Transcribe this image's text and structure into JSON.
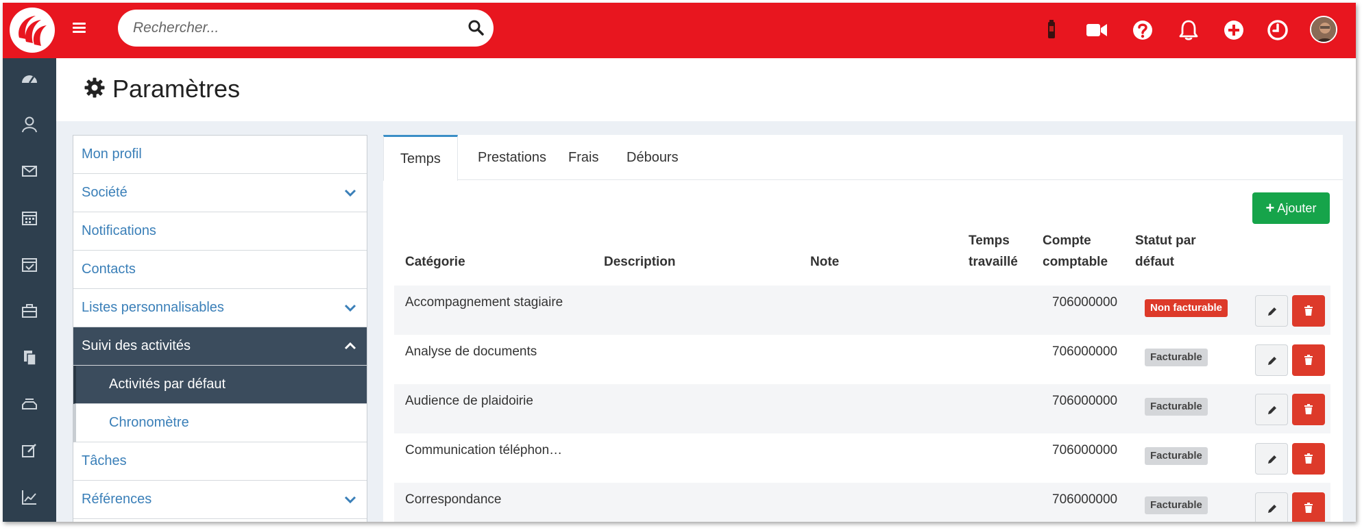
{
  "search": {
    "placeholder": "Rechercher..."
  },
  "page": {
    "title": "Paramètres"
  },
  "settings_menu": {
    "items": [
      {
        "label": "Mon profil"
      },
      {
        "label": "Société"
      },
      {
        "label": "Notifications"
      },
      {
        "label": "Contacts"
      },
      {
        "label": "Listes personnalisables"
      },
      {
        "label": "Suivi des activités"
      },
      {
        "label": "Activités par défaut"
      },
      {
        "label": "Chronomètre"
      },
      {
        "label": "Tâches"
      },
      {
        "label": "Références"
      }
    ]
  },
  "tabs": [
    {
      "label": "Temps"
    },
    {
      "label": "Prestations"
    },
    {
      "label": "Frais"
    },
    {
      "label": "Débours"
    }
  ],
  "add_button": {
    "label": "Ajouter"
  },
  "table": {
    "headers": {
      "categorie": "Catégorie",
      "description": "Description",
      "note": "Note",
      "temps_line1": "Temps",
      "temps_line2": "travaillé",
      "compte_line1": "Compte",
      "compte_line2": "comptable",
      "statut_line1": "Statut par",
      "statut_line2": "défaut"
    },
    "rows": [
      {
        "categorie": "Accompagnement stagiaire",
        "compte": "706000000",
        "statut": "Non facturable"
      },
      {
        "categorie": "Analyse de documents",
        "compte": "706000000",
        "statut": "Facturable"
      },
      {
        "categorie": "Audience de plaidoirie",
        "compte": "706000000",
        "statut": "Facturable"
      },
      {
        "categorie": "Communication téléphon…",
        "compte": "706000000",
        "statut": "Facturable"
      },
      {
        "categorie": "Correspondance",
        "compte": "706000000",
        "statut": "Facturable"
      }
    ]
  },
  "colors": {
    "brand_red": "#e8161f",
    "sidebar": "#2e3f4e",
    "success": "#16a44a",
    "danger": "#dd3a2a",
    "link": "#3a7fb8"
  }
}
